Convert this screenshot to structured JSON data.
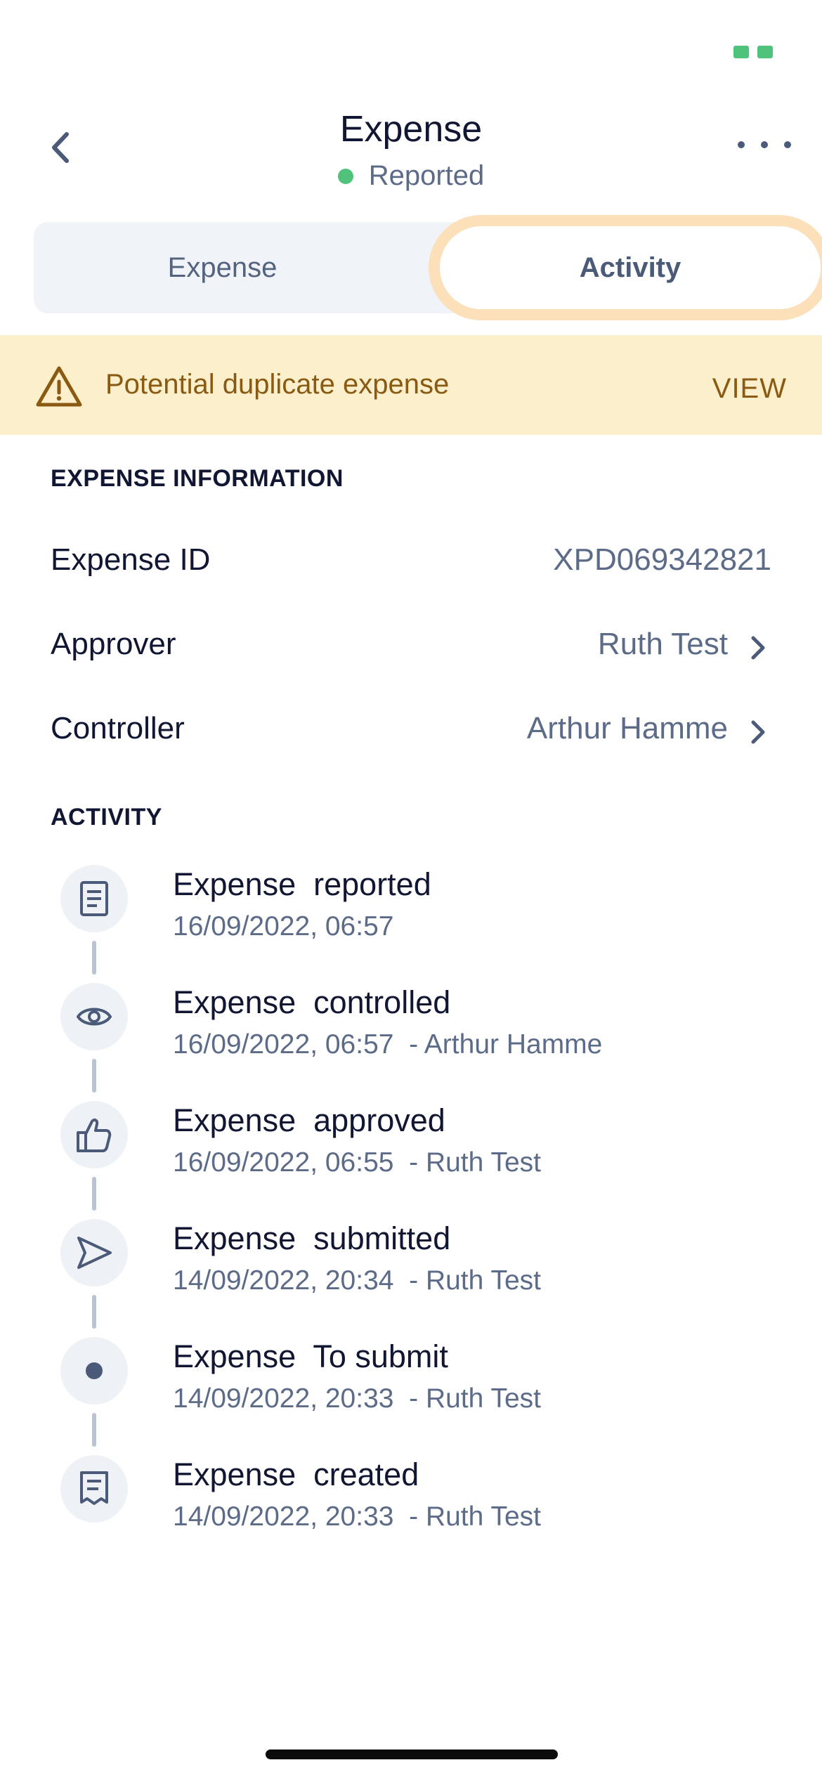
{
  "status_bar": {
    "battery_icon": "battery-icon",
    "battery_color": "#4fc27b"
  },
  "header": {
    "title": "Expense",
    "status": "Reported",
    "status_color": "#4fc27b",
    "back_icon": "chevron-left-icon",
    "more_icon": "more-horizontal-icon"
  },
  "tabs": [
    {
      "label": "Expense",
      "selected": false
    },
    {
      "label": "Activity",
      "selected": true
    }
  ],
  "banner": {
    "icon": "warning-triangle-icon",
    "text": "Potential duplicate expense",
    "action": "VIEW",
    "background": "#fcefcc",
    "text_color": "#8a5a12"
  },
  "expense_information": {
    "heading": "EXPENSE INFORMATION",
    "rows": [
      {
        "label": "Expense ID",
        "value": "XPD069342821"
      },
      {
        "label": "Approver",
        "value": "Ruth Test"
      },
      {
        "label": "Controller",
        "value": "Arthur Hamme"
      }
    ]
  },
  "activity": {
    "heading": "ACTIVITY",
    "items": [
      {
        "icon": "document-icon",
        "title": "Expense  reported",
        "subtitle": "16/09/2022, 06:57"
      },
      {
        "icon": "eye-icon",
        "title": "Expense  controlled",
        "subtitle": "16/09/2022, 06:57  - Arthur Hamme"
      },
      {
        "icon": "thumbs-up-icon",
        "title": "Expense  approved",
        "subtitle": "16/09/2022, 06:55  - Ruth Test"
      },
      {
        "icon": "send-icon",
        "title": "Expense  submitted",
        "subtitle": "14/09/2022, 20:34  - Ruth Test"
      },
      {
        "icon": "dot-icon",
        "title": "Expense  To submit",
        "subtitle": "14/09/2022, 20:33  - Ruth Test"
      },
      {
        "icon": "receipt-icon",
        "title": "Expense  created",
        "subtitle": "14/09/2022, 20:33  - Ruth Test"
      }
    ]
  }
}
